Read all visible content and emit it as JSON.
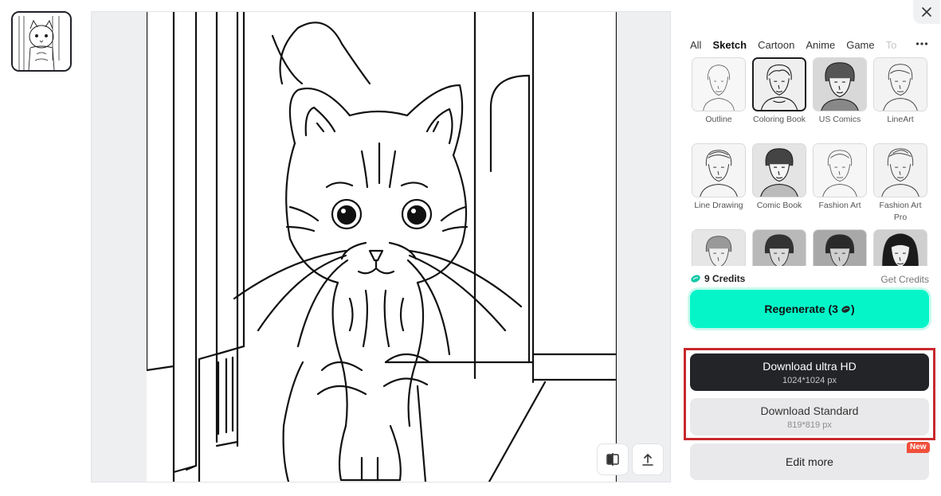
{
  "tabs": [
    {
      "label": "All"
    },
    {
      "label": "Sketch",
      "active": true
    },
    {
      "label": "Cartoon"
    },
    {
      "label": "Anime"
    },
    {
      "label": "Game"
    },
    {
      "label": "To"
    }
  ],
  "styles": [
    {
      "label": "Outline"
    },
    {
      "label": "Coloring Book",
      "selected": true
    },
    {
      "label": "US Comics"
    },
    {
      "label": "LineArt"
    },
    {
      "label": "Line Drawing"
    },
    {
      "label": "Comic Book"
    },
    {
      "label": "Fashion Art"
    },
    {
      "label": "Fashion Art Pro"
    },
    {
      "label": ""
    },
    {
      "label": ""
    },
    {
      "label": ""
    },
    {
      "label": ""
    }
  ],
  "credits": {
    "label": "9 Credits",
    "get_label": "Get Credits"
  },
  "regenerate": {
    "label": "Regenerate (3",
    "suffix": ")"
  },
  "download_hd": {
    "title": "Download ultra HD",
    "size": "1024*1024 px"
  },
  "download_std": {
    "title": "Download Standard",
    "size": "819*819 px"
  },
  "edit_more": {
    "label": "Edit more",
    "badge": "New"
  },
  "colors": {
    "accent": "#05f5c9",
    "dark": "#232428",
    "highlight": "#c8282d",
    "badge": "#f04f3a"
  }
}
